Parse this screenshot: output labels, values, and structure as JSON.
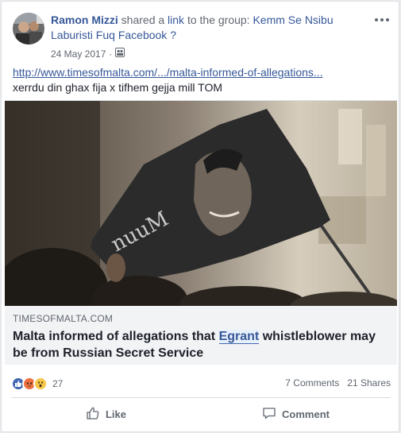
{
  "post": {
    "author": "Ramon Mizzi",
    "shared_text": "shared a",
    "link_word": "link",
    "to_group_text": "to the group:",
    "group_name": "Kemm Se Nsibu Laburisti Fuq Facebook ?",
    "date": "24 May 2017",
    "audience_icon": "group-audience-icon",
    "more_icon": "more-options-icon",
    "url_text": "http://www.timesofmalta.com/.../malta-informed-of-allegations...",
    "message": "xerrdu din ghax fija x tifhem gejja mill TOM"
  },
  "attachment": {
    "domain": "TIMESOFMALTA.COM",
    "title_before": "Malta informed of allegations that ",
    "title_highlight": "Egrant",
    "title_after": " whistleblower may be from Russian Secret Service"
  },
  "stats": {
    "reaction_icons": [
      "like",
      "angry",
      "wow"
    ],
    "reaction_count": "27",
    "comments": "7 Comments",
    "shares": "21 Shares"
  },
  "actions": {
    "like_label": "Like",
    "comment_label": "Comment"
  },
  "colors": {
    "link": "#365899",
    "like_blue": "#4267b2",
    "angry_orange": "#f0703f",
    "wow_yellow": "#f7c748"
  }
}
